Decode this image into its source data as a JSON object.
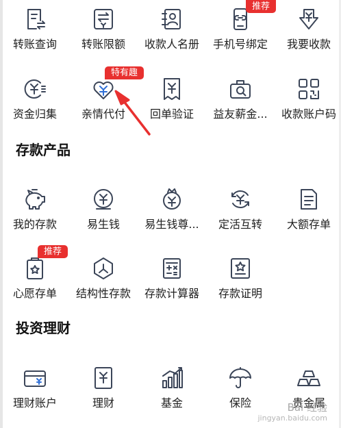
{
  "accent_color": "#e8302f",
  "icon_color": "#3b4558",
  "top_row": [
    {
      "label": "转账查询",
      "icon": "transfer-query-icon"
    },
    {
      "label": "转账限额",
      "icon": "transfer-limit-icon"
    },
    {
      "label": "收款人名册",
      "icon": "payee-list-icon"
    },
    {
      "label": "手机号绑定",
      "icon": "phone-bind-icon",
      "badge": "推荐"
    },
    {
      "label": "我要收款",
      "icon": "receive-money-icon"
    }
  ],
  "second_row": [
    {
      "label": "资金归集",
      "icon": "fund-collect-icon"
    },
    {
      "label": "亲情代付",
      "icon": "family-pay-icon",
      "badge": "特有趣"
    },
    {
      "label": "回单验证",
      "icon": "receipt-verify-icon"
    },
    {
      "label": "益友薪金...",
      "icon": "salary-icon"
    },
    {
      "label": "收款账户码",
      "icon": "qr-code-icon"
    }
  ],
  "deposit": {
    "title": "存款产品",
    "row1": [
      {
        "label": "我的存款",
        "icon": "piggy-bank-icon"
      },
      {
        "label": "易生钱",
        "icon": "yisheng-coin-icon"
      },
      {
        "label": "易生钱尊...",
        "icon": "yisheng-premium-icon"
      },
      {
        "label": "定活互转",
        "icon": "exchange-icon"
      },
      {
        "label": "大额存单",
        "icon": "large-deposit-icon"
      }
    ],
    "row2": [
      {
        "label": "心愿存单",
        "icon": "wish-deposit-icon",
        "badge": "推荐"
      },
      {
        "label": "结构性存款",
        "icon": "structured-deposit-icon"
      },
      {
        "label": "存款计算器",
        "icon": "calculator-icon"
      },
      {
        "label": "存款证明",
        "icon": "deposit-certificate-icon"
      }
    ]
  },
  "invest": {
    "title": "投资理财",
    "row1": [
      {
        "label": "理财账户",
        "icon": "wealth-account-icon"
      },
      {
        "label": "理财",
        "icon": "wealth-icon"
      },
      {
        "label": "基金",
        "icon": "fund-chart-icon"
      },
      {
        "label": "保险",
        "icon": "umbrella-icon"
      },
      {
        "label": "贵金属",
        "icon": "gold-bars-icon"
      }
    ]
  },
  "watermark": {
    "brand": "Bai 经验",
    "url": "jingyan.baidu.com"
  }
}
